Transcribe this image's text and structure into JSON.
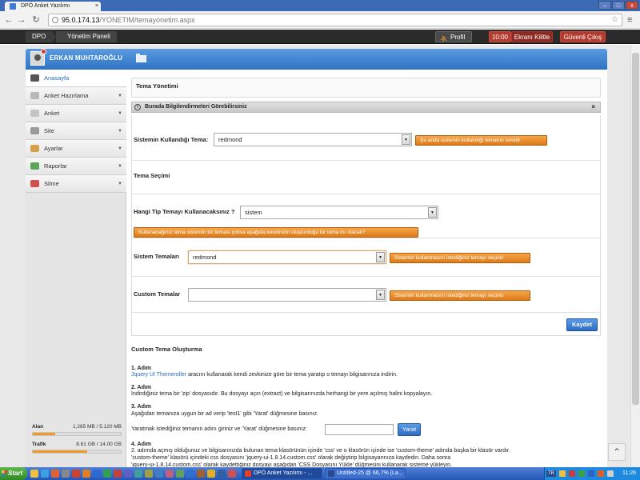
{
  "browser": {
    "tab_title": "DPÖ Anket Yazılımı",
    "tab_close": "×",
    "url_host": "95.0.174.13",
    "url_path": "/YONETIM/temayonetim.aspx",
    "win_minimize": "–",
    "win_maximize": "□",
    "win_close": "x"
  },
  "topbar": {
    "brand": "DPO",
    "breadcrumb": "Yönetim Paneli",
    "profile": "Profil",
    "timer": "10:00",
    "lock": "Ekranı Kilitle",
    "logout": "Güvenli Çıkış"
  },
  "user": {
    "name": "ERKAN MUHTAROĞLU"
  },
  "sidebar": {
    "items": [
      {
        "label": "Anasayfa",
        "icon": "home-icon"
      },
      {
        "label": "Anket Hazırlama",
        "icon": "edit-icon"
      },
      {
        "label": "Anket",
        "icon": "list-icon"
      },
      {
        "label": "Site",
        "icon": "globe-icon"
      },
      {
        "label": "Ayarlar",
        "icon": "wrench-icon"
      },
      {
        "label": "Raporlar",
        "icon": "report-icon"
      },
      {
        "label": "Silme",
        "icon": "delete-icon"
      }
    ],
    "chevron": "▼"
  },
  "storage": {
    "alan_label": "Alan",
    "alan_value": "1,285 MB / 5,120 MB",
    "alan_fraction": 0.25,
    "trafik_label": "Trafik",
    "trafik_value": "8.61 GB / 14.00 GB",
    "trafik_fraction": 0.615
  },
  "content": {
    "title": "Tema Yönetimi",
    "info_bar": "Burada Bilgilendirmeleri Görebilirsiniz",
    "info_close": "×",
    "system_theme_label": "Sistemin Kullandığı Tema:",
    "system_theme_value": "redmond",
    "system_theme_btn": "Şu anda sistemin kullandığı temanın ismidir",
    "theme_selection_title": "Tema Seçimi",
    "theme_type_label": "Hangi Tip Temayı Kullanacaksınız ?",
    "theme_type_value": "sistem",
    "theme_type_btn": "Kullanacağınız tema sistemin bir teması yoksa aşağıda kendinizin oluşturduğu bir tema mı olacak?",
    "system_themes_label": "Sistem Temaları",
    "system_themes_value": "redmond",
    "system_themes_btn": "Sistemin kullanmasını istediğiniz temayı seçiniz",
    "custom_themes_label": "Custom Temalar",
    "custom_themes_value": "",
    "custom_themes_btn": "Sistemin kullanmasını istediğiniz temayı seçiniz",
    "save_btn": "Kaydet",
    "dropdown_arrow": "▼"
  },
  "custom": {
    "title": "Custom Tema Oluşturma",
    "step1_h": "1. Adım",
    "step1_link": "Jquery UI Themeroller",
    "step1_text": " aracını kullanarak kendi zevkinize göre bir tema yaratıp o temayı bilgisarınıza indirin.",
    "step2_h": "2. Adım",
    "step2_text": "İndirdiğiniz tema bir 'zip' dosyasıdır. Bu dosyayı açın (extract) ve bilgisarınızda herhangi bir yere açılmış halini kopyalayın.",
    "step3_h": "3. Adım",
    "step3_text": "Aşağıdan temanıza uygun bir ad verip 'test1' gibi 'Yarat' düğmesine basınız.",
    "create_prompt": "Yaratmak istediğiniz temanın adını giriniz ve 'Yarat' düğmesine basınız:",
    "create_input_value": "",
    "create_btn": "Yarat",
    "step4_h": "4. Adım",
    "step4_line1": "2. adımda açmış olduğunuz ve bilgisarınızda bulunan tema klasörünün içinde 'css' ve o klasörün içinde ise 'custom-theme' adında başka bir klasör vardır.",
    "step4_line2": "'custom-theme' klasörü içindeki css dosyasını  'jquery-ui-1.8.14.custom.css' olarak değiştirip bilgisayarınıza kaydedin. Daha sonra",
    "step4_line3": "'jquery-ui-1.8.14.custom.css' olarak kaydettiğiniz dosyayı aşağıdan 'CSS Dosyasını Yükle' düğmesini kullanarak sisteme yükleyin."
  },
  "scroll_top_icon": "⌃",
  "taskbar": {
    "start": "Start",
    "task1": "DPÖ Anket Yazılımı - ...",
    "task2": "Untitled-25 @ 66,7% (La...",
    "clock": "11:26",
    "tray_lang": "TR"
  },
  "colors": {
    "accent_blue": "#2f73c4",
    "orange_btn": "#dd7a18",
    "topbar": "#2b2b2b",
    "logout_red": "#b23a2e"
  }
}
